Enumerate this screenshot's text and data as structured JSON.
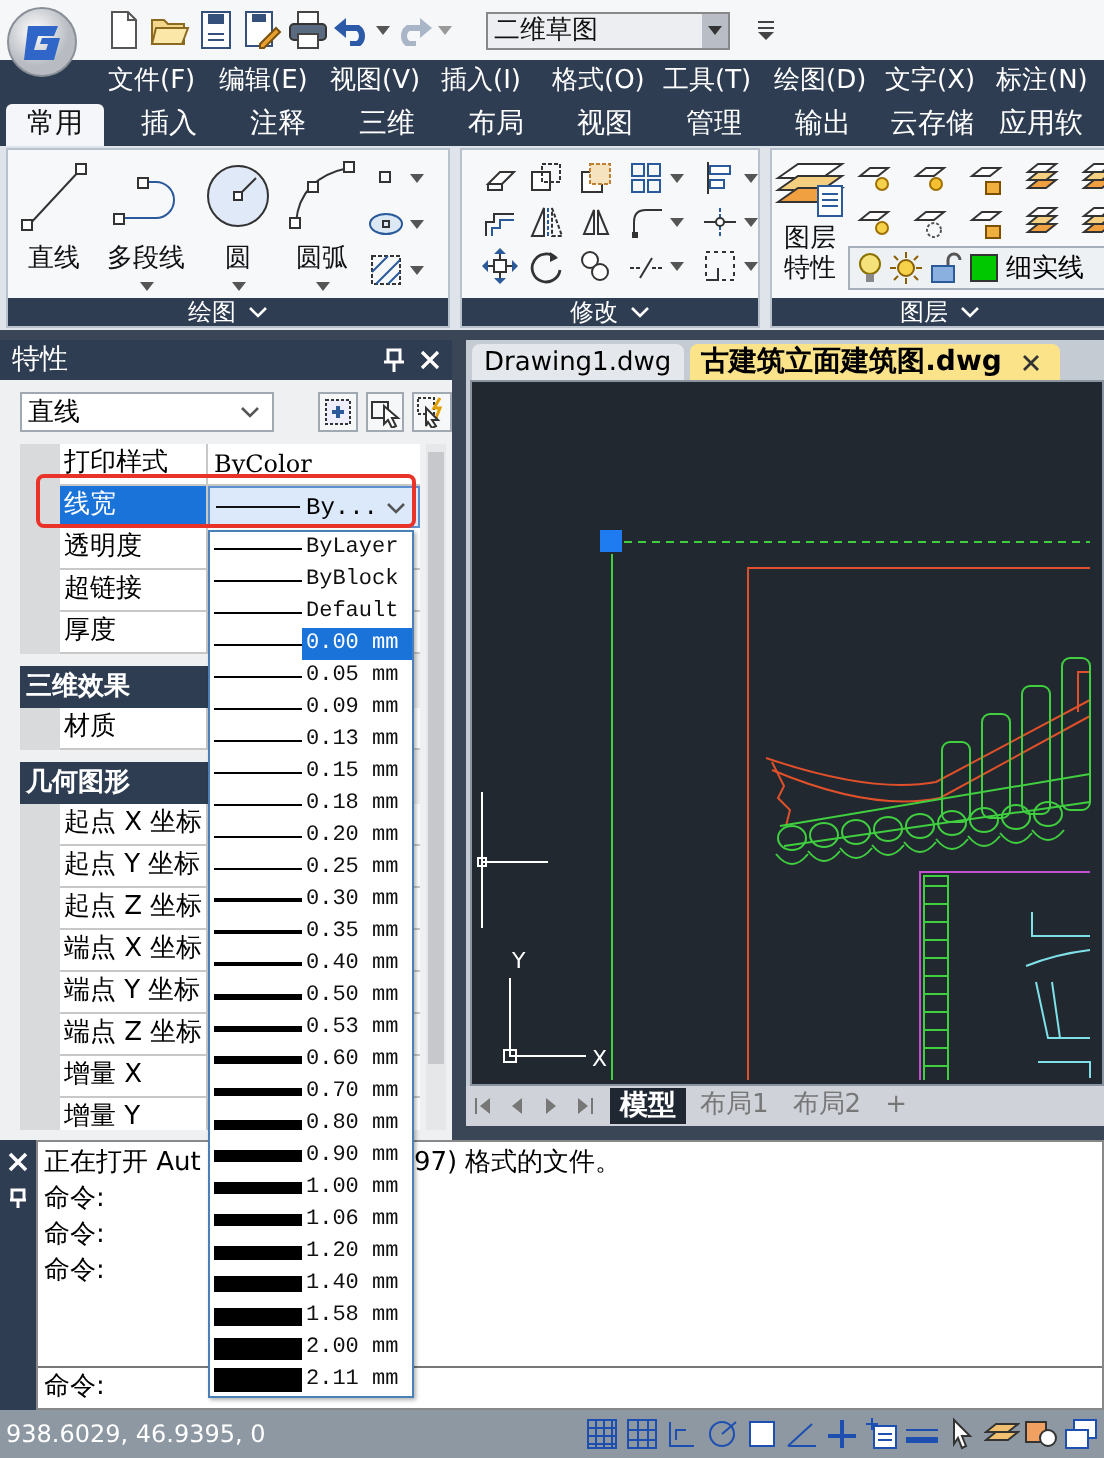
{
  "quick_access": {
    "workspace": "二维草图"
  },
  "menu_bar": [
    "文件(F)",
    "编辑(E)",
    "视图(V)",
    "插入(I)",
    "格式(O)",
    "工具(T)",
    "绘图(D)",
    "文字(X)",
    "标注(N)"
  ],
  "ribbon": {
    "tabs": [
      {
        "label": "常用",
        "selected": true
      },
      {
        "label": "插入",
        "selected": false
      },
      {
        "label": "注释",
        "selected": false
      },
      {
        "label": "三维",
        "selected": false
      },
      {
        "label": "布局",
        "selected": false
      },
      {
        "label": "视图",
        "selected": false
      },
      {
        "label": "管理",
        "selected": false
      },
      {
        "label": "输出",
        "selected": false
      },
      {
        "label": "云存储",
        "selected": false
      },
      {
        "label": "应用软",
        "selected": false
      }
    ],
    "groups": [
      {
        "kind": "draw",
        "title": "绘图",
        "buttons": [
          "直线",
          "多段线",
          "圆",
          "圆弧"
        ]
      },
      {
        "kind": "modify",
        "title": "修改"
      },
      {
        "kind": "layers",
        "title": "图层",
        "buttons": [
          "图层特性"
        ],
        "layer": {
          "name": "细实线",
          "color": "#00c800"
        }
      }
    ]
  },
  "properties": {
    "title": "特性",
    "object_type": "直线",
    "groups": [
      {
        "rows": [
          {
            "label": "打印样式",
            "value": "ByColor",
            "selected": false
          },
          {
            "label": "线宽",
            "value": "By...",
            "selected": true
          },
          {
            "label": "透明度",
            "selected": false
          },
          {
            "label": "超链接",
            "selected": false
          },
          {
            "label": "厚度",
            "selected": false
          }
        ]
      },
      {
        "title": "三维效果",
        "rows": [
          {
            "label": "材质",
            "selected": false
          }
        ]
      },
      {
        "title": "几何图形",
        "rows": [
          {
            "label": "起点 X 坐标",
            "selected": false
          },
          {
            "label": "起点 Y 坐标",
            "selected": false
          },
          {
            "label": "起点 Z 坐标",
            "selected": false
          },
          {
            "label": "端点 X 坐标",
            "selected": false
          },
          {
            "label": "端点 Y 坐标",
            "selected": false
          },
          {
            "label": "端点 Z 坐标",
            "selected": false
          },
          {
            "label": "增量 X",
            "selected": false
          },
          {
            "label": "增量 Y",
            "selected": false
          }
        ]
      }
    ]
  },
  "lineweight_list": {
    "items": [
      {
        "label": "ByLayer",
        "selected": false
      },
      {
        "label": "ByBlock",
        "selected": false
      },
      {
        "label": "Default",
        "selected": false
      },
      {
        "label": "0.00 mm",
        "selected": true
      },
      {
        "label": "0.05 mm",
        "selected": false
      },
      {
        "label": "0.09 mm",
        "selected": false
      },
      {
        "label": "0.13 mm",
        "selected": false
      },
      {
        "label": "0.15 mm",
        "selected": false
      },
      {
        "label": "0.18 mm",
        "selected": false
      },
      {
        "label": "0.20 mm",
        "selected": false
      },
      {
        "label": "0.25 mm",
        "selected": false
      },
      {
        "label": "0.30 mm",
        "selected": false
      },
      {
        "label": "0.35 mm",
        "selected": false
      },
      {
        "label": "0.40 mm",
        "selected": false
      },
      {
        "label": "0.50 mm",
        "selected": false
      },
      {
        "label": "0.53 mm",
        "selected": false
      },
      {
        "label": "0.60 mm",
        "selected": false
      },
      {
        "label": "0.70 mm",
        "selected": false
      },
      {
        "label": "0.80 mm",
        "selected": false
      },
      {
        "label": "0.90 mm",
        "selected": false
      },
      {
        "label": "1.00 mm",
        "selected": false
      },
      {
        "label": "1.06 mm",
        "selected": false
      },
      {
        "label": "1.20 mm",
        "selected": false
      },
      {
        "label": "1.40 mm",
        "selected": false
      },
      {
        "label": "1.58 mm",
        "selected": false
      },
      {
        "label": "2.00 mm",
        "selected": false
      },
      {
        "label": "2.11 mm",
        "selected": false
      }
    ]
  },
  "document_tabs": [
    {
      "label": "Drawing1.dwg",
      "selected": false
    },
    {
      "label": "古建筑立面建筑图.dwg",
      "selected": true
    }
  ],
  "drawing": {
    "ucs_y": "Y",
    "ucs_x": "X"
  },
  "layout_tabs": [
    {
      "label": "模型",
      "selected": true
    },
    {
      "label": "布局1",
      "selected": false
    },
    {
      "label": "布局2",
      "selected": false
    },
    {
      "label": "+",
      "selected": false
    }
  ],
  "command_line": {
    "history": [
      {
        "parts": [
          "正在打开 Aut",
          "97) 格式的文件。"
        ]
      },
      {
        "parts": [
          "命令:"
        ]
      },
      {
        "parts": [
          "命令:"
        ]
      },
      {
        "parts": [
          "命令:"
        ]
      }
    ],
    "prompt": "命令:"
  },
  "status_bar": {
    "coordinates": "938.6029, 46.9395, 0"
  }
}
